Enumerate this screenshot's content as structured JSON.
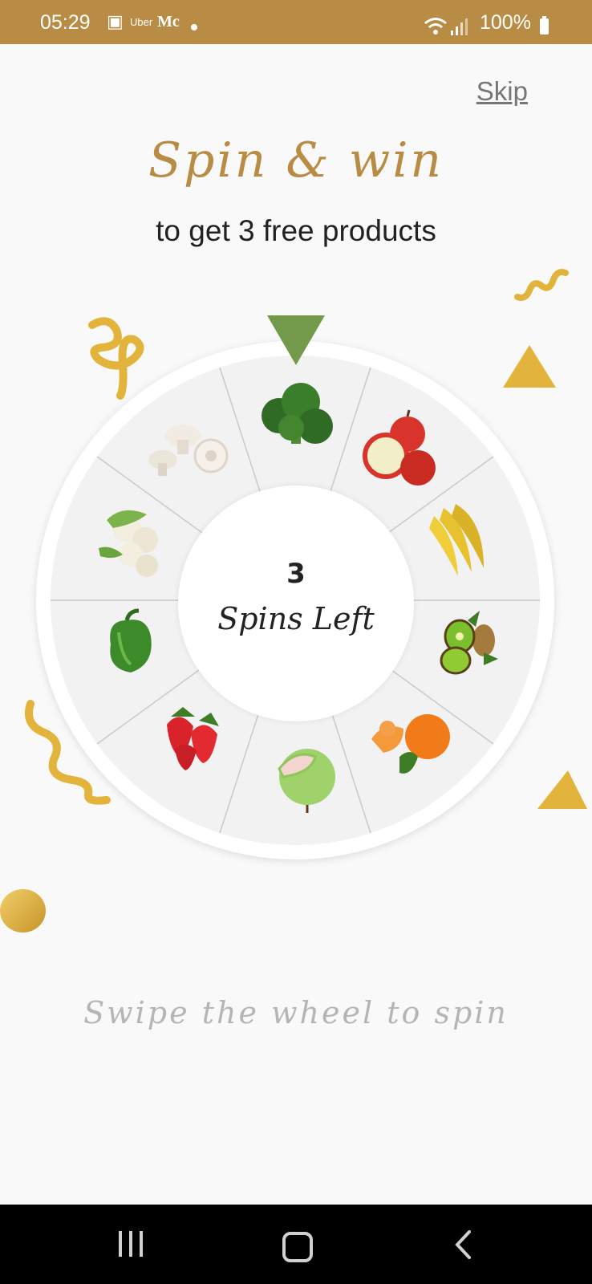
{
  "status_bar": {
    "time": "05:29",
    "notification_app1": "Uber",
    "notification_app2": "Mc",
    "battery": "100%"
  },
  "header": {
    "skip_label": "Skip",
    "title": "Spin & win",
    "subtitle": "to get 3 free products"
  },
  "wheel": {
    "spins_count": "3",
    "spins_label": "Spins Left",
    "segments": [
      "broccoli",
      "apples",
      "bananas",
      "kiwi",
      "oranges",
      "guava",
      "strawberries",
      "green pepper",
      "cauliflower",
      "mushrooms"
    ],
    "pointer_color": "#739a4a"
  },
  "footer": {
    "hint": "Swipe the wheel to spin"
  },
  "colors": {
    "brand": "#b98c45",
    "gold": "#e2b43b"
  }
}
